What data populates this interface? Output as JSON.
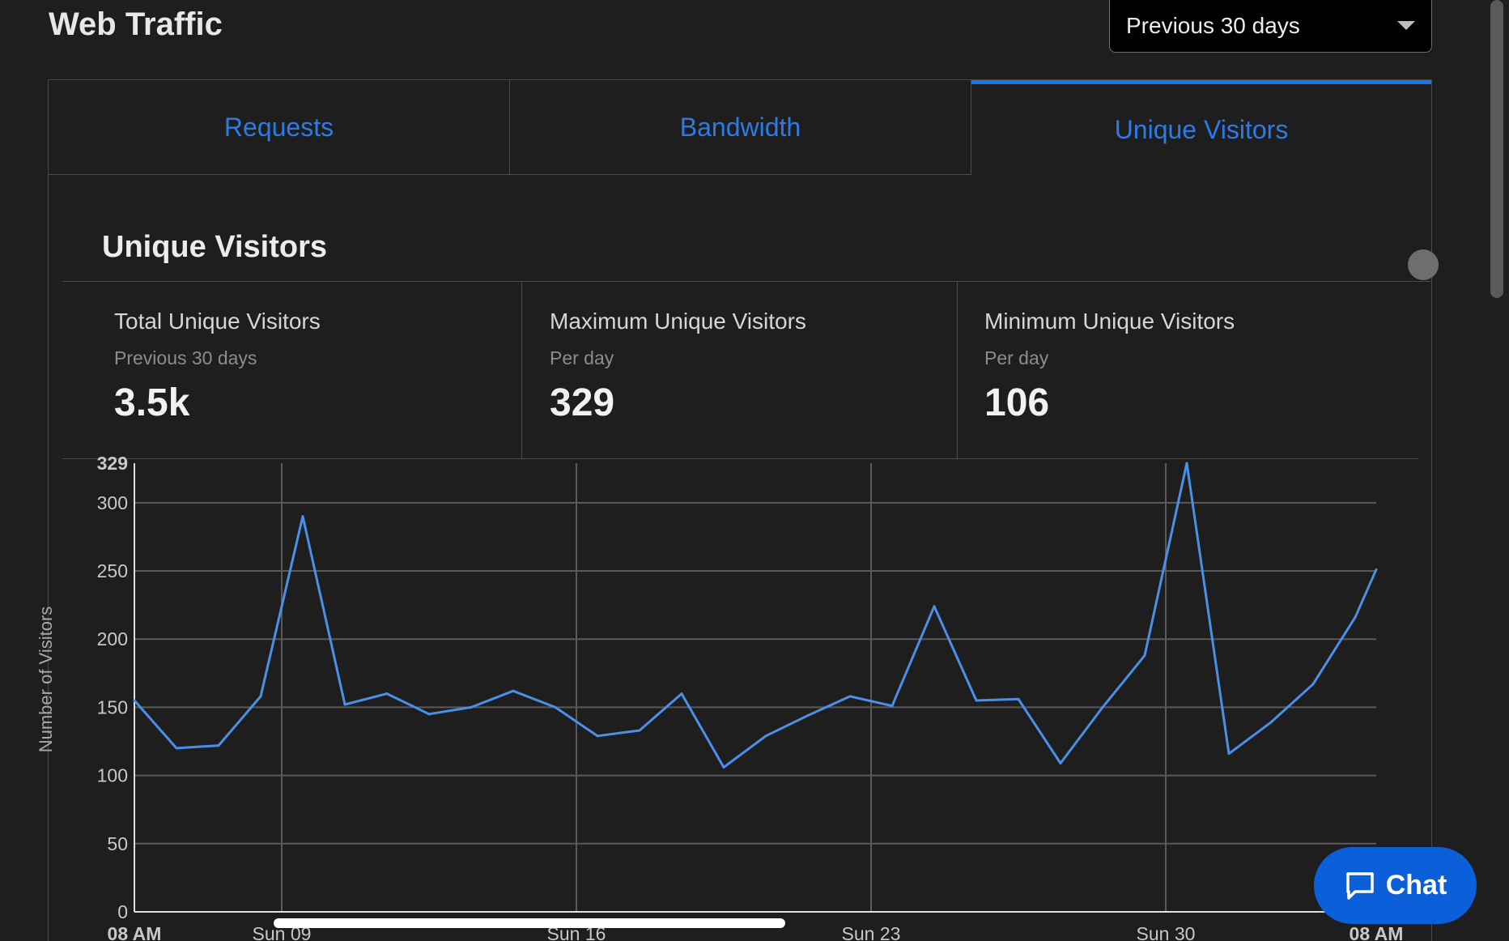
{
  "header": {
    "title": "Web Traffic",
    "range_selected": "Previous 30 days"
  },
  "tabs": [
    {
      "label": "Requests",
      "active": false
    },
    {
      "label": "Bandwidth",
      "active": false
    },
    {
      "label": "Unique Visitors",
      "active": true
    }
  ],
  "section": {
    "title": "Unique Visitors"
  },
  "stats": [
    {
      "label": "Total Unique Visitors",
      "sub": "Previous 30 days",
      "value": "3.5k"
    },
    {
      "label": "Maximum Unique Visitors",
      "sub": "Per day",
      "value": "329"
    },
    {
      "label": "Minimum Unique Visitors",
      "sub": "Per day",
      "value": "106"
    }
  ],
  "chat": {
    "label": "Chat"
  },
  "colors": {
    "accent": "#1b73e8",
    "line": "#4a90e8",
    "chat_bg": "#0b5fd9"
  },
  "chart_data": {
    "type": "line",
    "ylabel": "Number of Visitors",
    "ylim": [
      0,
      329
    ],
    "yticks": [
      0,
      50,
      100,
      150,
      200,
      250,
      300,
      329
    ],
    "x_index_range": [
      0,
      29.5
    ],
    "xticks": [
      {
        "label": "08 AM",
        "pos": 0
      },
      {
        "label": "Sun 09",
        "pos": 3.5
      },
      {
        "label": "Sun 16",
        "pos": 10.5
      },
      {
        "label": "Sun 23",
        "pos": 17.5
      },
      {
        "label": "Sun 30",
        "pos": 24.5
      },
      {
        "label": "08 AM",
        "pos": 29.5
      }
    ],
    "grid": true,
    "series": [
      {
        "x": [
          0,
          1,
          2,
          3,
          4,
          5,
          6,
          7,
          8,
          9,
          10,
          11,
          12,
          13,
          14,
          15,
          16,
          17,
          18,
          19,
          20,
          21,
          22,
          23,
          24,
          25,
          26,
          27,
          28,
          29,
          29.5
        ],
        "values": [
          155,
          120,
          122,
          158,
          290,
          152,
          160,
          145,
          150,
          162,
          150,
          129,
          133,
          160,
          106,
          129,
          144,
          158,
          151,
          224,
          155,
          156,
          109,
          150,
          188,
          329,
          116,
          139,
          167,
          216,
          251
        ]
      }
    ]
  }
}
